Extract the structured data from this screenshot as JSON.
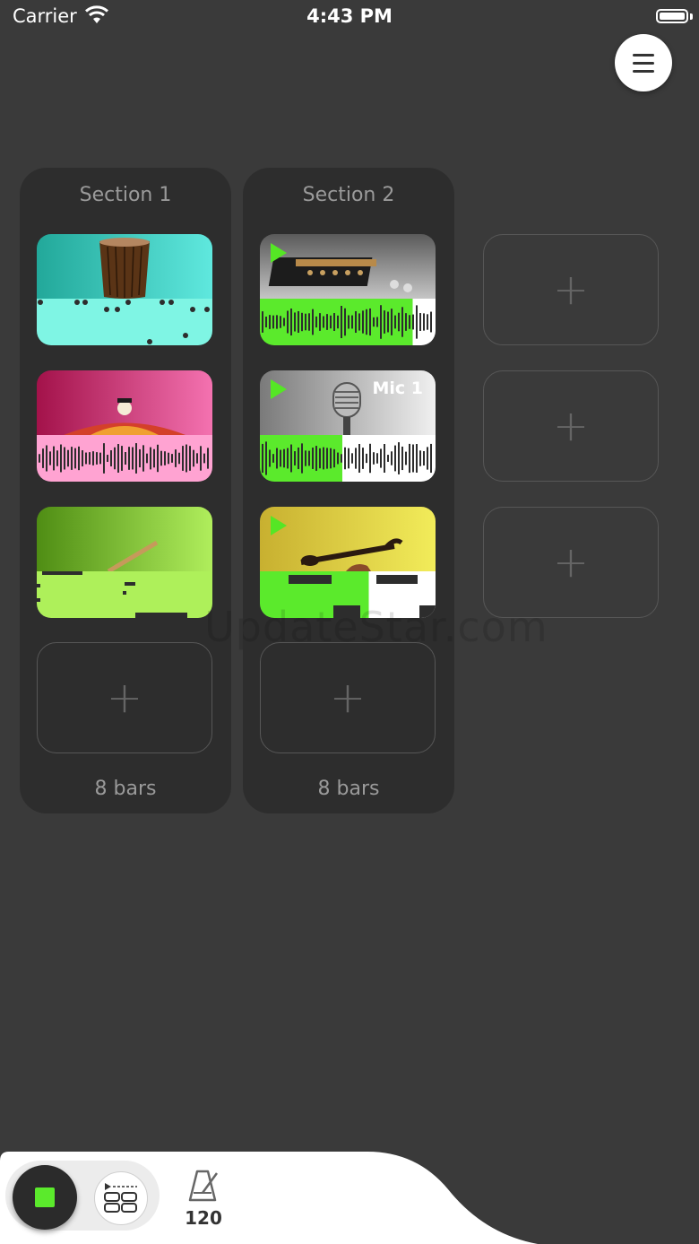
{
  "status_bar": {
    "carrier": "Carrier",
    "time": "4:43 PM"
  },
  "sections": [
    {
      "title": "Section 1",
      "length": "8 bars"
    },
    {
      "title": "Section 2",
      "length": "8 bars"
    }
  ],
  "clips": {
    "mic_label": "Mic 1"
  },
  "add_symbol": "+",
  "transport": {
    "tempo": "120"
  },
  "watermark": "UpdateStar.com",
  "colors": {
    "background": "#3a3a3a",
    "section_panel": "#2d2d2d",
    "accent_green": "#5bea2c",
    "drum_cyan": "#7ff5e4",
    "vocal_pink": "#ffa3d2",
    "flute_lime": "#aef05a"
  }
}
